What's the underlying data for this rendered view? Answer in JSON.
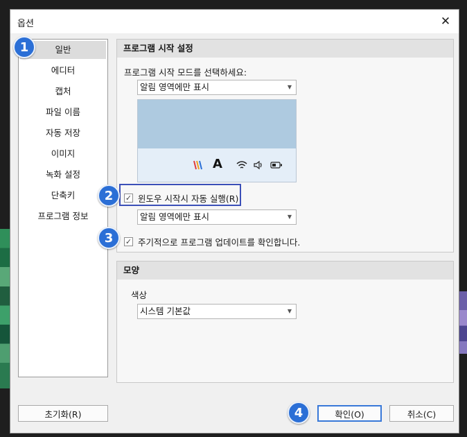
{
  "window": {
    "title": "옵션",
    "close_glyph": "✕"
  },
  "sidebar": {
    "items": [
      {
        "label": "일반"
      },
      {
        "label": "에디터"
      },
      {
        "label": "캡처"
      },
      {
        "label": "파일 이름"
      },
      {
        "label": "자동 저장"
      },
      {
        "label": "이미지"
      },
      {
        "label": "녹화 설정"
      },
      {
        "label": "단축키"
      },
      {
        "label": "프로그램 정보"
      }
    ],
    "selected_index": 0
  },
  "startup": {
    "heading": "프로그램 시작 설정",
    "mode_prompt": "프로그램 시작 모드를 선택하세요:",
    "mode_select": "알림 영역에만 표시",
    "autorun_label": "윈도우 시작시 자동 실행(R)",
    "autorun_checked": true,
    "autorun_select": "알림 영역에만 표시",
    "update_label": "주기적으로 프로그램 업데이트를 확인합니다.",
    "update_checked": true,
    "check_glyph": "✓"
  },
  "tray_preview": {
    "letter": "A",
    "icons": [
      "app-logo-icon",
      "font-a-icon",
      "wifi-icon",
      "speaker-icon",
      "battery-icon"
    ]
  },
  "appearance": {
    "heading": "모양",
    "color_label": "색상",
    "color_select": "시스템 기본값"
  },
  "buttons": {
    "reset": "초기화(R)",
    "ok": "확인(O)",
    "cancel": "취소(C)"
  },
  "annotations": [
    "1",
    "2",
    "3",
    "4"
  ],
  "colors": {
    "badge": "#2b6fd6",
    "highlight": "#3b4fb8",
    "default_button_border": "#3878d8"
  }
}
